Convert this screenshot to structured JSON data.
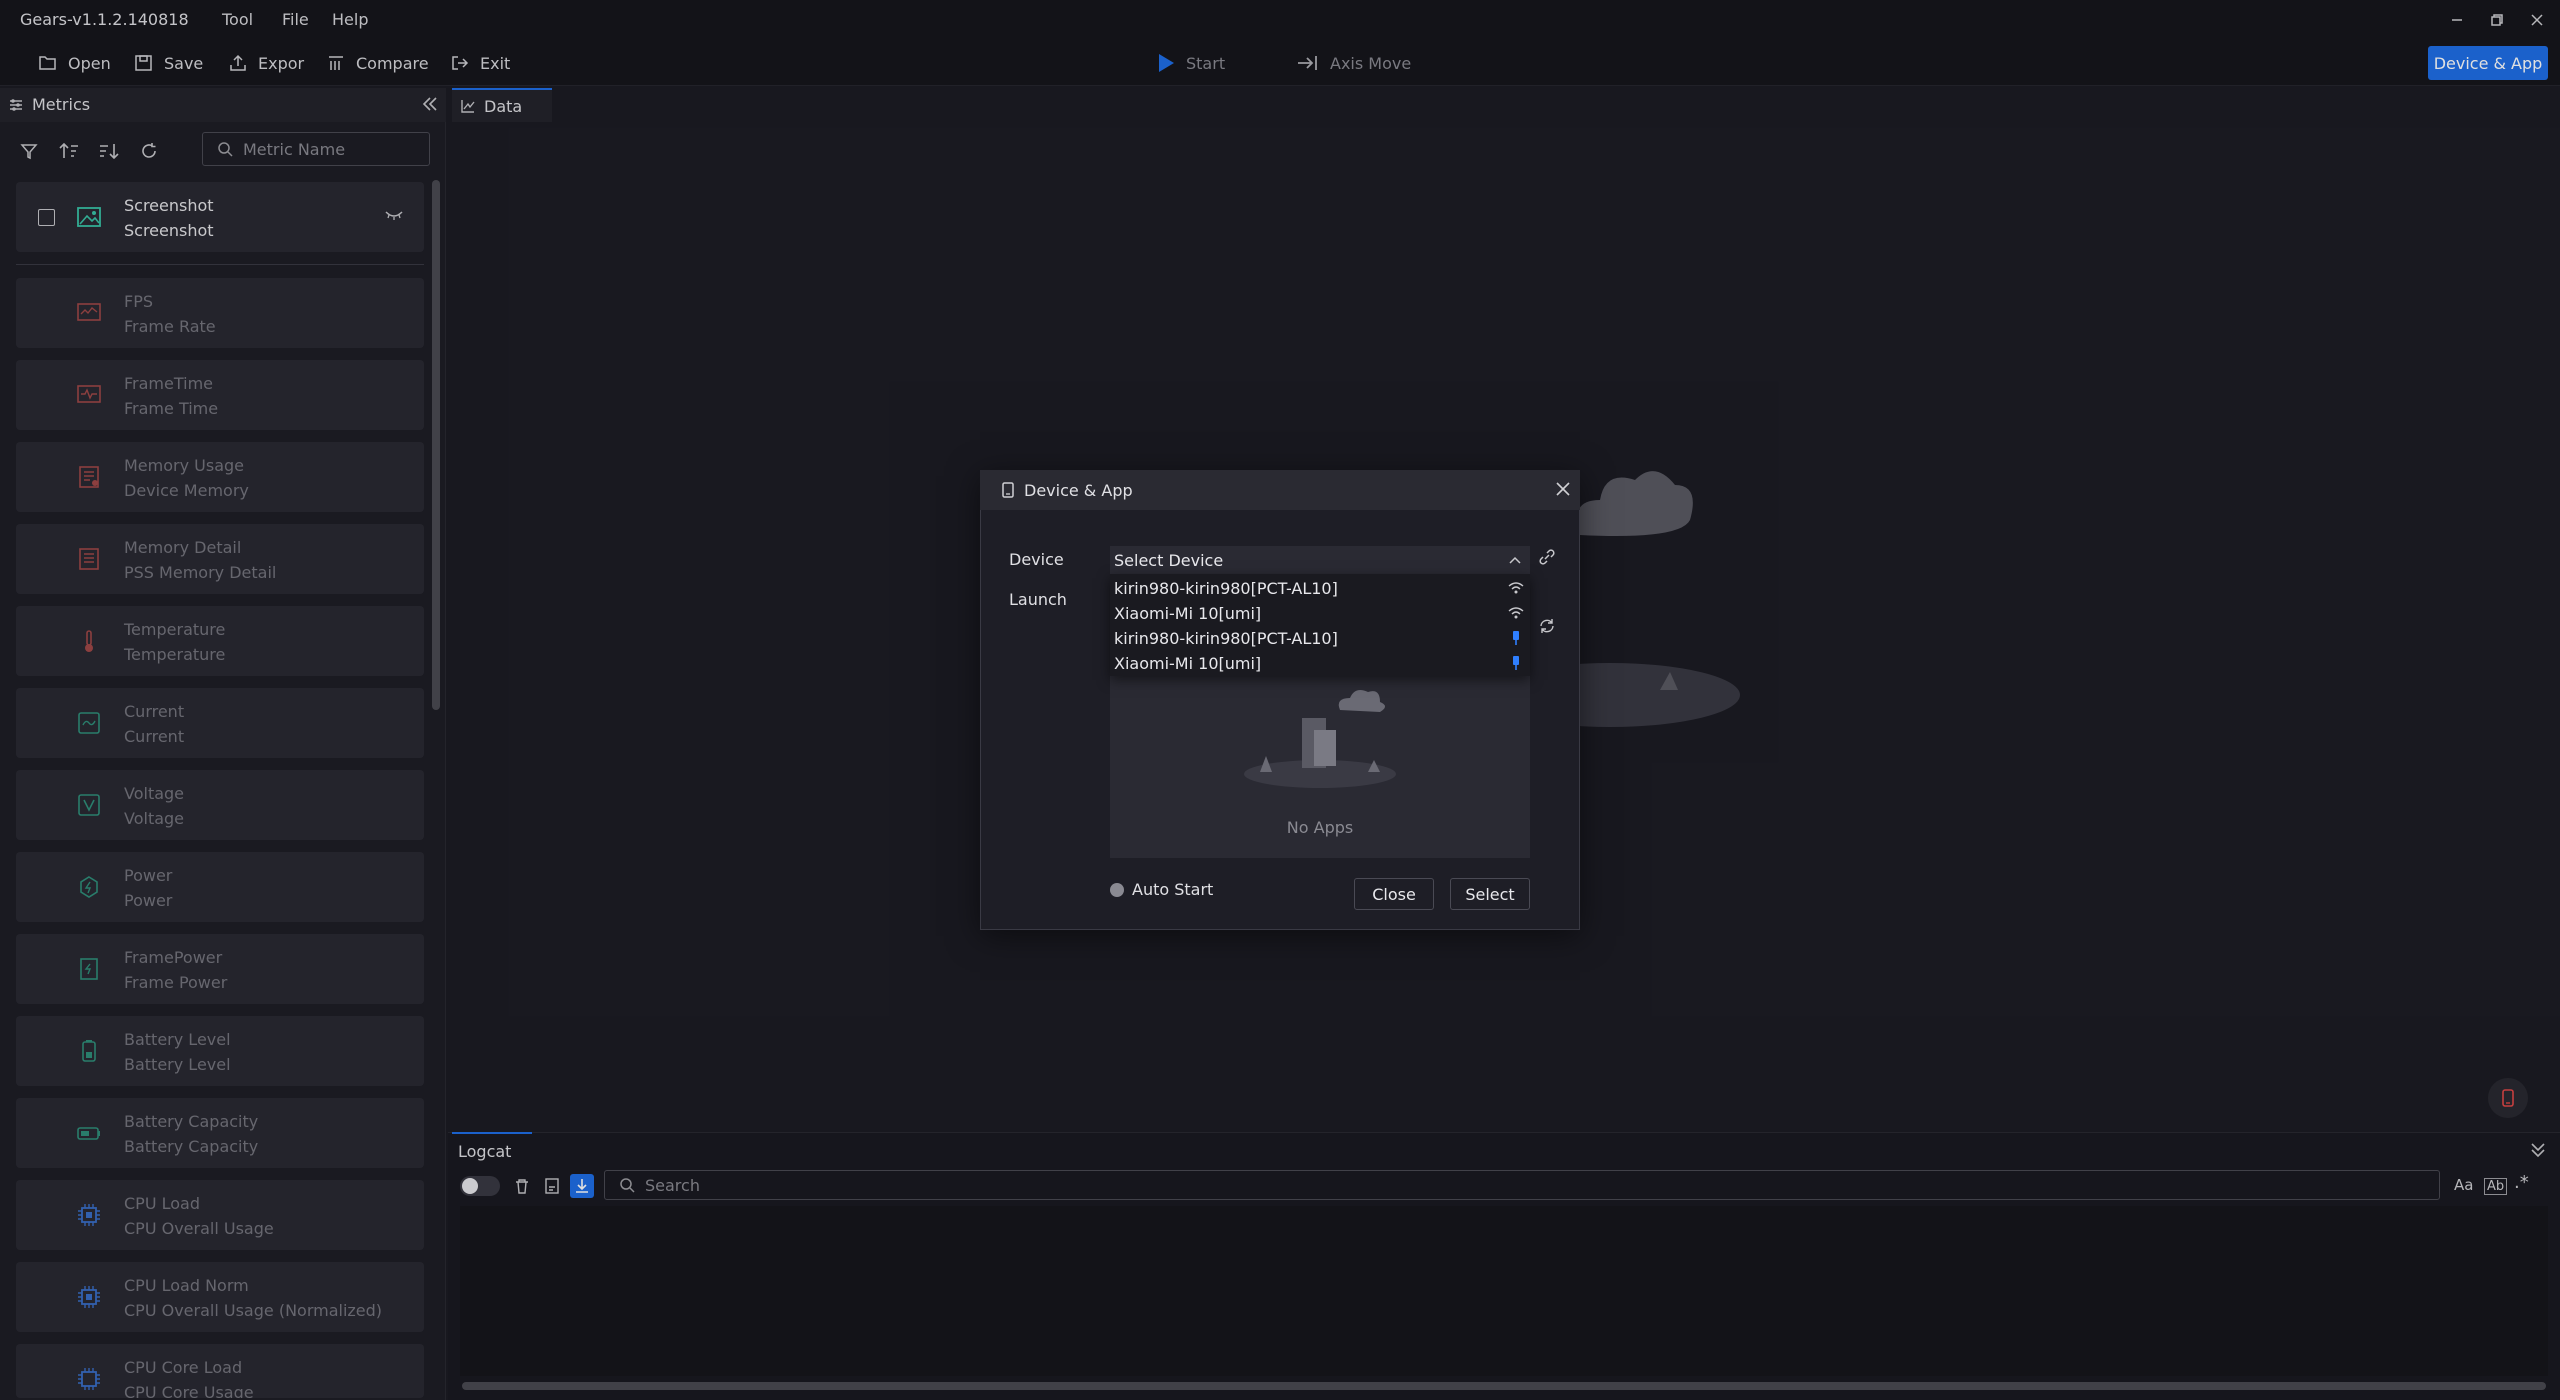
{
  "app": {
    "title": "Gears-v1.1.2.140818"
  },
  "menu": [
    {
      "label": "Tool"
    },
    {
      "label": "File"
    },
    {
      "label": "Help"
    }
  ],
  "toolbar": {
    "open": "Open",
    "save": "Save",
    "export": "Expor",
    "compare": "Compare",
    "exit": "Exit",
    "start": "Start",
    "axis_move": "Axis Move",
    "device_app": "Device & App"
  },
  "left_panel": {
    "tab_label": "Metrics",
    "search_placeholder": "Metric Name",
    "screenshot": {
      "title": "Screenshot",
      "subtitle": "Screenshot"
    },
    "metrics": [
      {
        "title": "FPS",
        "subtitle": "Frame Rate",
        "icon": "fps-icon",
        "color": "#a04848"
      },
      {
        "title": "FrameTime",
        "subtitle": "Frame Time",
        "icon": "frametime-icon",
        "color": "#a04848"
      },
      {
        "title": "Memory Usage",
        "subtitle": "Device Memory",
        "icon": "memory-icon",
        "color": "#a04848"
      },
      {
        "title": "Memory Detail",
        "subtitle": "PSS Memory Detail",
        "icon": "memory-detail-icon",
        "color": "#a04848"
      },
      {
        "title": "Temperature",
        "subtitle": "Temperature",
        "icon": "thermometer-icon",
        "color": "#a04848"
      },
      {
        "title": "Current",
        "subtitle": "Current",
        "icon": "current-icon",
        "color": "#2f8f7a"
      },
      {
        "title": "Voltage",
        "subtitle": "Voltage",
        "icon": "voltage-icon",
        "color": "#2f8f7a"
      },
      {
        "title": "Power",
        "subtitle": "Power",
        "icon": "power-icon",
        "color": "#2f8f7a"
      },
      {
        "title": "FramePower",
        "subtitle": "Frame Power",
        "icon": "frame-power-icon",
        "color": "#2f8f7a"
      },
      {
        "title": "Battery Level",
        "subtitle": "Battery Level",
        "icon": "battery-icon",
        "color": "#2f8f7a"
      },
      {
        "title": "Battery Capacity",
        "subtitle": "Battery Capacity",
        "icon": "battery-capacity-icon",
        "color": "#2f8f7a"
      },
      {
        "title": "CPU Load",
        "subtitle": "CPU Overall Usage",
        "icon": "cpu-icon",
        "color": "#3a6fc8"
      },
      {
        "title": "CPU Load Norm",
        "subtitle": "CPU Overall Usage (Normalized)",
        "icon": "cpu-norm-icon",
        "color": "#3a6fc8"
      },
      {
        "title": "CPU Core Load",
        "subtitle": "CPU Core Usage",
        "icon": "cpu-core-icon",
        "color": "#3a6fc8"
      }
    ]
  },
  "main": {
    "data_tab": "Data"
  },
  "logcat": {
    "tab_label": "Logcat",
    "search_placeholder": "Search",
    "opt_case": "Aa",
    "opt_word": "Ab",
    "opt_regex": ".*"
  },
  "modal": {
    "title": "Device & App",
    "device_label": "Device",
    "launch_label": "Launch",
    "select_placeholder": "Select Device",
    "devices": [
      {
        "name": "kirin980-kirin980[PCT-AL10]",
        "connection": "wifi"
      },
      {
        "name": "Xiaomi-Mi 10[umi]",
        "connection": "wifi"
      },
      {
        "name": "kirin980-kirin980[PCT-AL10]",
        "connection": "usb"
      },
      {
        "name": "Xiaomi-Mi 10[umi]",
        "connection": "usb"
      }
    ],
    "no_apps": "No Apps",
    "auto_start": "Auto Start",
    "close_btn": "Close",
    "select_btn": "Select"
  },
  "colors": {
    "accent": "#1f6fe8",
    "panel": "#2a2a33",
    "bg": "#1c1c24"
  }
}
